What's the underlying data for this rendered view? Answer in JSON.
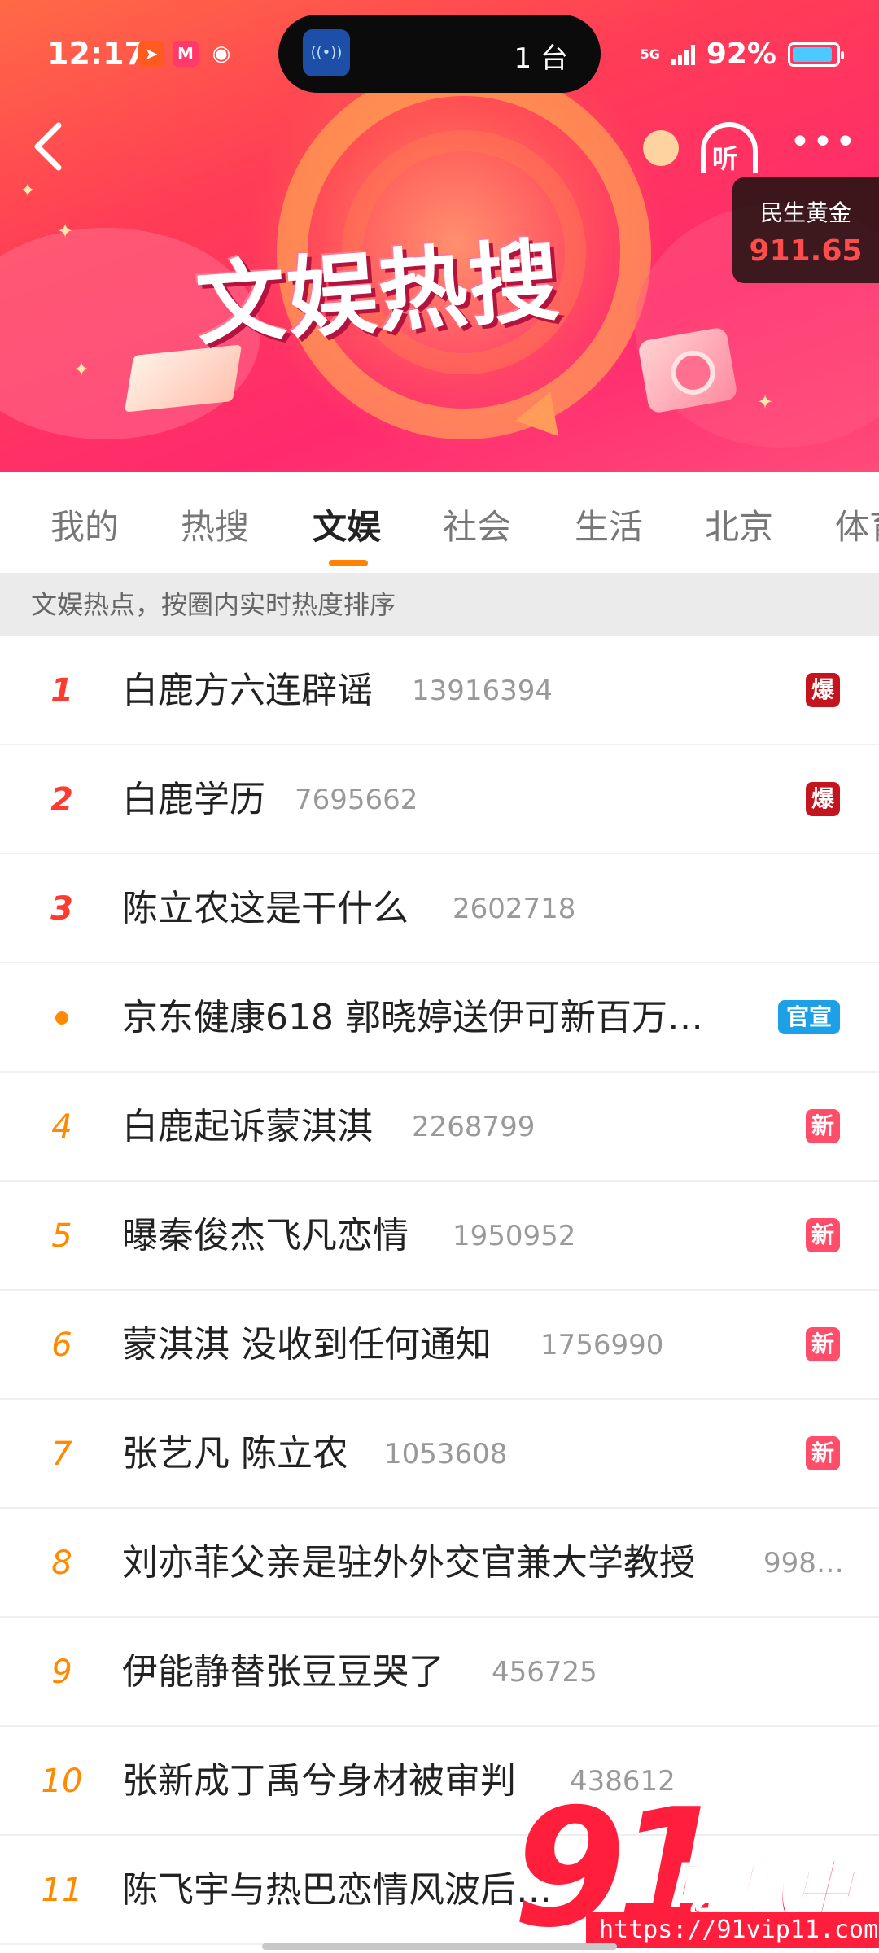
{
  "status_bar": {
    "time": "12:17",
    "island_text": "1 台",
    "network": "5G",
    "battery": "92%",
    "battery_level": 0.92
  },
  "header": {
    "banner_title": "文娱热搜",
    "listen_label": "听",
    "more_label": "•••"
  },
  "stock": {
    "name": "民生黄金",
    "value": "911.65",
    "color": "#ff4d4d"
  },
  "tabs": [
    {
      "label": "我的"
    },
    {
      "label": "热搜"
    },
    {
      "label": "文娱",
      "active": true
    },
    {
      "label": "社会"
    },
    {
      "label": "生活"
    },
    {
      "label": "北京"
    },
    {
      "label": "体育"
    }
  ],
  "subheader": "文娱热点，按圈内实时热度排序",
  "list": [
    {
      "rank": "1",
      "title": "白鹿方六连辟谣",
      "count": "13916394",
      "badge": "爆"
    },
    {
      "rank": "2",
      "title": "白鹿学历",
      "count": "7695662",
      "badge": "爆"
    },
    {
      "rank": "3",
      "title": "陈立农这是干什么",
      "count": "2602718",
      "badge": ""
    },
    {
      "rank": "",
      "title": "京东健康618 郭晓婷送伊可新百万…",
      "count": "",
      "badge": "官宣"
    },
    {
      "rank": "4",
      "title": "白鹿起诉蒙淇淇",
      "count": "2268799",
      "badge": "新"
    },
    {
      "rank": "5",
      "title": "曝秦俊杰飞凡恋情",
      "count": "1950952",
      "badge": "新"
    },
    {
      "rank": "6",
      "title": "蒙淇淇 没收到任何通知",
      "count": "1756990",
      "badge": "新"
    },
    {
      "rank": "7",
      "title": "张艺凡 陈立农",
      "count": "1053608",
      "badge": "新"
    },
    {
      "rank": "8",
      "title": "刘亦菲父亲是驻外外交官兼大学教授",
      "count": "998…",
      "badge": ""
    },
    {
      "rank": "9",
      "title": "伊能静替张豆豆哭了",
      "count": "456725",
      "badge": ""
    },
    {
      "rank": "10",
      "title": "张新成丁禹兮身材被审判",
      "count": "438612",
      "badge": ""
    },
    {
      "rank": "11",
      "title": "陈飞宇与热巴恋情风波后…",
      "count": "",
      "badge": ""
    }
  ],
  "watermark": {
    "big": "91",
    "cn": "吃瓜中心",
    "url": "https://91vip11.com"
  },
  "colors": {
    "accent": "#ff8200",
    "rank_top": "#ff3b30",
    "rank_mid": "#ff8a00",
    "badge_bao": "#c4141d",
    "badge_new": "#ff4d6a",
    "badge_official": "#1da0e6"
  }
}
